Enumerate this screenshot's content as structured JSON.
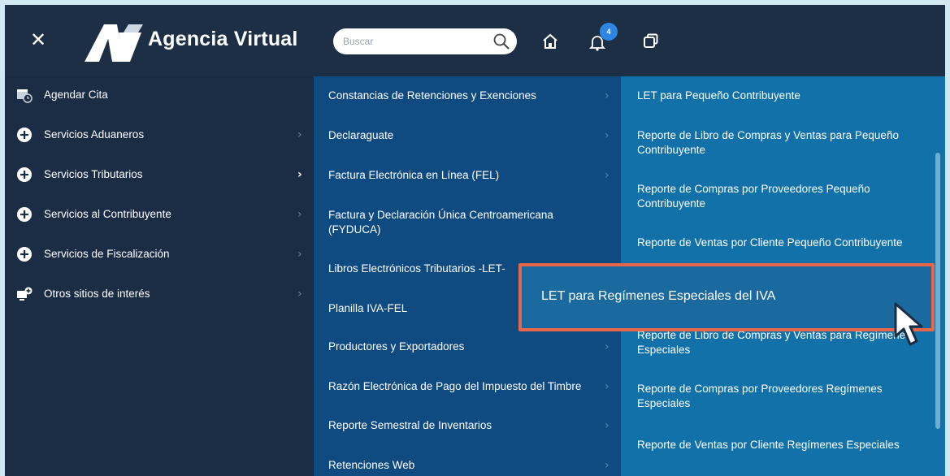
{
  "header": {
    "brand": "Agencia Virtual",
    "search": {
      "placeholder": "Buscar",
      "value": ""
    },
    "notifications_count": "4"
  },
  "menu_level1": [
    {
      "label": "Agendar Cita",
      "icon": "calendar-clock-icon"
    },
    {
      "label": "Servicios Aduaneros",
      "icon": "plus-circle-icon"
    },
    {
      "label": "Servicios Tributarios",
      "icon": "plus-circle-icon",
      "active": true
    },
    {
      "label": "Servicios al Contribuyente",
      "icon": "plus-circle-icon"
    },
    {
      "label": "Servicios de Fiscalización",
      "icon": "plus-circle-icon"
    },
    {
      "label": "Otros sitios de interés",
      "icon": "external-sites-icon"
    }
  ],
  "menu_level2": [
    {
      "label": "Constancias de Retenciones y Exenciones"
    },
    {
      "label": "Declaraguate"
    },
    {
      "label": "Factura Electrónica en Línea (FEL)"
    },
    {
      "label": "Factura y Declaración Única Centroamericana (FYDUCA)"
    },
    {
      "label": "Libros Electrónicos Tributarios -LET-"
    },
    {
      "label": "Planilla IVA-FEL"
    },
    {
      "label": "Productores y Exportadores"
    },
    {
      "label": "Razón Electrónica de Pago del Impuesto del Timbre"
    },
    {
      "label": "Reporte Semestral de Inventarios"
    },
    {
      "label": "Retenciones Web"
    }
  ],
  "menu_level3": [
    {
      "label": "LET para Pequeño Contribuyente"
    },
    {
      "label": "Reporte de Libro de Compras y Ventas para Pequeño Contribuyente"
    },
    {
      "label": "Reporte de Compras por Proveedores Pequeño Contribuyente"
    },
    {
      "label": "Reporte de Ventas por Cliente Pequeño Contribuyente"
    },
    {
      "label": "LET para Regímenes Especiales del IVA"
    },
    {
      "label": "Reporte de Libro de Compras y Ventas para Regímenes Especiales"
    },
    {
      "label": "Reporte de Compras por Proveedores Regímenes Especiales"
    },
    {
      "label": "Reporte de Ventas por Cliente Regímenes Especiales"
    }
  ],
  "colors": {
    "header_bg": "#1c2f45",
    "level2_bg": "#0f4a80",
    "level3_bg": "#1171a8",
    "highlight_border": "#e8674a",
    "badge": "#2e86e4"
  }
}
